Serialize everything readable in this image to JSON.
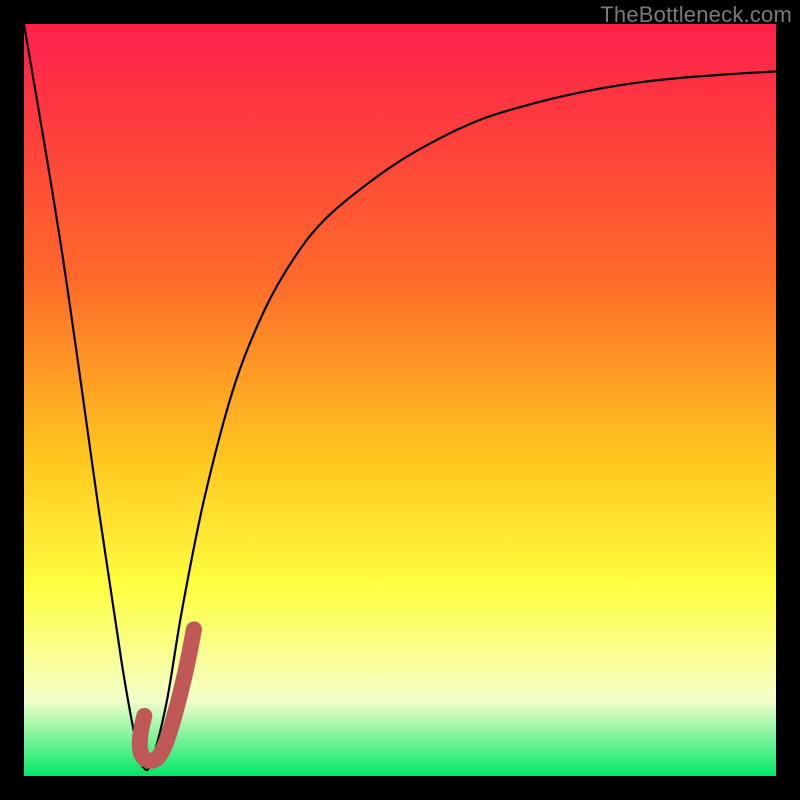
{
  "watermark": "TheBottleneck.com",
  "colors": {
    "bg": "#000000",
    "grad_top": "#ff1f4b",
    "grad_mid1": "#ff6a2a",
    "grad_mid2": "#ffc81e",
    "grad_mid3": "#ffff40",
    "grad_low": "#f4ffca",
    "grad_bottom": "#00e768",
    "curve": "#000000",
    "marker": "#c15858"
  },
  "chart_data": {
    "type": "line",
    "title": "",
    "xlabel": "",
    "ylabel": "",
    "xlim": [
      0,
      100
    ],
    "ylim": [
      0,
      100
    ],
    "series": [
      {
        "name": "bottleneck-curve",
        "x": [
          0,
          5,
          10,
          13,
          15,
          16,
          17,
          19,
          21,
          24,
          28,
          32,
          36,
          40,
          46,
          52,
          60,
          68,
          76,
          84,
          92,
          100
        ],
        "values": [
          100,
          70,
          35,
          15,
          4,
          1,
          2,
          10,
          22,
          37,
          52,
          62,
          69,
          74,
          79,
          83,
          87,
          89.5,
          91.3,
          92.5,
          93.2,
          93.7
        ]
      }
    ],
    "marker": {
      "name": "selected-range-hook",
      "path_xy": [
        [
          16.0,
          8.0
        ],
        [
          15.6,
          6.2
        ],
        [
          15.4,
          4.6
        ],
        [
          15.5,
          3.2
        ],
        [
          16.2,
          2.2
        ],
        [
          17.5,
          2.2
        ],
        [
          18.7,
          4.0
        ],
        [
          20.0,
          8.0
        ],
        [
          21.5,
          14.0
        ],
        [
          22.6,
          19.5
        ]
      ],
      "stroke_width_px": 16
    },
    "gradient_stops_pct": [
      {
        "pos": 0,
        "key": "grad_top"
      },
      {
        "pos": 34,
        "key": "grad_mid1"
      },
      {
        "pos": 58,
        "key": "grad_mid2"
      },
      {
        "pos": 75,
        "key": "grad_mid3"
      },
      {
        "pos": 90,
        "key": "grad_low"
      },
      {
        "pos": 100,
        "key": "grad_bottom"
      }
    ]
  }
}
